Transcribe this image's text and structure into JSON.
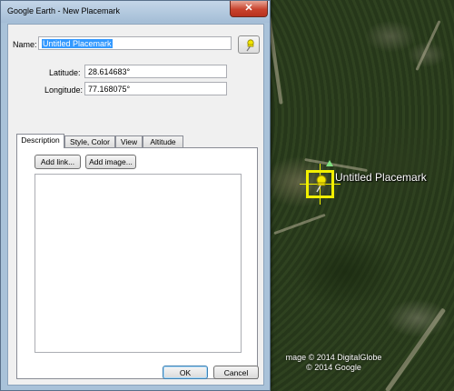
{
  "window": {
    "title": "Google Earth - New Placemark",
    "close_label": "✕"
  },
  "form": {
    "name_label": "Name:",
    "name_value": "Untitled Placemark",
    "latitude_label": "Latitude:",
    "latitude_value": "28.614683°",
    "longitude_label": "Longitude:",
    "longitude_value": "77.168075°"
  },
  "tabs": [
    {
      "label": "Description",
      "active": true
    },
    {
      "label": "Style, Color",
      "active": false
    },
    {
      "label": "View",
      "active": false
    },
    {
      "label": "Altitude",
      "active": false
    }
  ],
  "description": {
    "add_link_label": "Add link...",
    "add_image_label": "Add image..."
  },
  "buttons": {
    "ok_label": "OK",
    "cancel_label": "Cancel"
  },
  "map": {
    "placemark_label": "Untitled Placemark",
    "attribution_line1": "mage © 2014 DigitalGlobe",
    "attribution_line2": "© 2014 Google"
  },
  "colors": {
    "placemark_yellow": "#f2f000",
    "dialog_frame": "#a9c2d9",
    "selection": "#3399ff"
  },
  "icons": {
    "placemark_icon": "yellow-pushpin-icon"
  }
}
